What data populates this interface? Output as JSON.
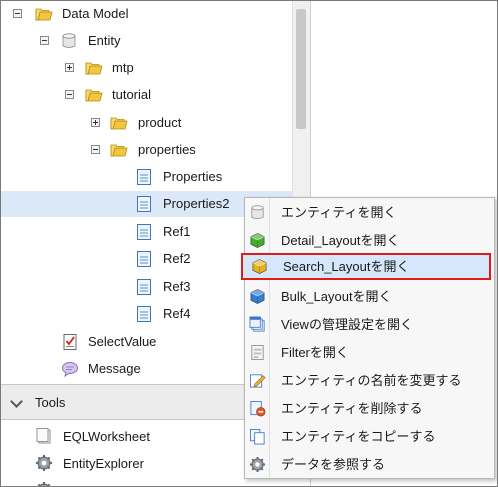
{
  "tree": {
    "data_model": "Data Model",
    "entity": "Entity",
    "mtp": "mtp",
    "tutorial": "tutorial",
    "product": "product",
    "properties_folder": "properties",
    "properties": "Properties",
    "properties2": "Properties2",
    "ref1": "Ref1",
    "ref2": "Ref2",
    "ref3": "Ref3",
    "ref4": "Ref4",
    "select_value": "SelectValue",
    "message": "Message"
  },
  "tools": {
    "header": "Tools",
    "eql_worksheet": "EQLWorksheet",
    "entity_explorer": "EntityExplorer"
  },
  "context_menu": {
    "items": [
      {
        "label": "エンティティを開く",
        "icon": "entity-cylinder-icon"
      },
      {
        "label": "Detail_Layoutを開く",
        "icon": "green-cube-icon"
      },
      {
        "label": "Search_Layoutを開く",
        "icon": "yellow-cube-icon"
      },
      {
        "label": "Bulk_Layoutを開く",
        "icon": "blue-cube-icon"
      },
      {
        "label": "Viewの管理設定を開く",
        "icon": "view-settings-icon"
      },
      {
        "label": "Filterを開く",
        "icon": "filter-icon"
      },
      {
        "label": "エンティティの名前を変更する",
        "icon": "rename-pencil-icon"
      },
      {
        "label": "エンティティを削除する",
        "icon": "delete-icon"
      },
      {
        "label": "エンティティをコピーする",
        "icon": "copy-icon"
      },
      {
        "label": "データを参照する",
        "icon": "data-gear-icon"
      }
    ]
  },
  "colors": {
    "selection": "#dbe8f8",
    "highlight_border": "#e01b1b",
    "folder": "#f3c63f"
  }
}
